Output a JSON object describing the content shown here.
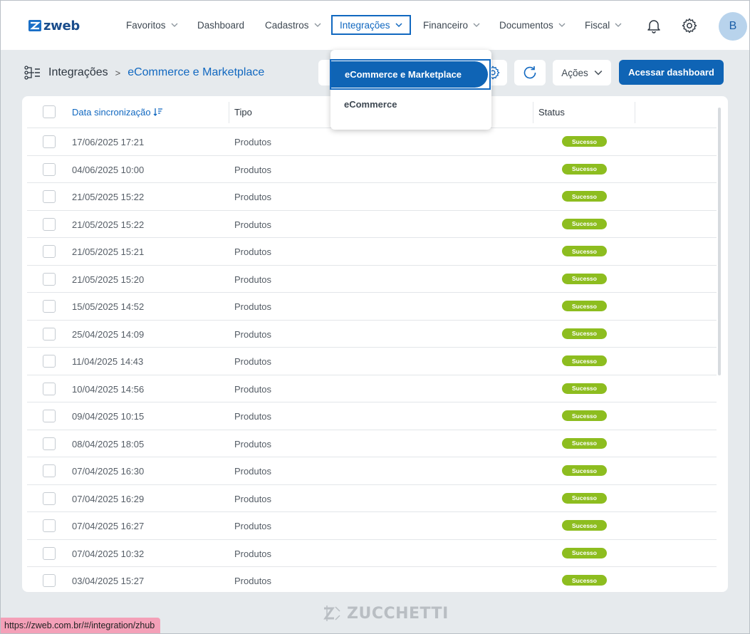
{
  "app": {
    "logo_text": "zweb"
  },
  "nav": {
    "items": [
      {
        "label": "Favoritos",
        "has_dropdown": true
      },
      {
        "label": "Dashboard",
        "has_dropdown": false
      },
      {
        "label": "Cadastros",
        "has_dropdown": true
      },
      {
        "label": "Integrações",
        "has_dropdown": true,
        "active": true
      },
      {
        "label": "Financeiro",
        "has_dropdown": true
      },
      {
        "label": "Documentos",
        "has_dropdown": true
      },
      {
        "label": "Fiscal",
        "has_dropdown": true
      }
    ],
    "avatar_initial": "B"
  },
  "breadcrumb": {
    "root": "Integrações",
    "separator": ">",
    "current": "eCommerce e Marketplace"
  },
  "toolbar": {
    "actions_label": "Ações",
    "primary_label": "Acessar dashboard"
  },
  "dropdown": {
    "items": [
      {
        "label": "eCommerce e Marketplace",
        "selected": true
      },
      {
        "label": "eCommerce",
        "selected": false
      }
    ]
  },
  "table": {
    "columns": {
      "date": "Data sincronização",
      "tipo": "Tipo",
      "status": "Status"
    },
    "rows": [
      {
        "date": "17/06/2025 17:21",
        "tipo": "Produtos",
        "status": "Sucesso"
      },
      {
        "date": "04/06/2025 10:00",
        "tipo": "Produtos",
        "status": "Sucesso"
      },
      {
        "date": "21/05/2025 15:22",
        "tipo": "Produtos",
        "status": "Sucesso"
      },
      {
        "date": "21/05/2025 15:22",
        "tipo": "Produtos",
        "status": "Sucesso"
      },
      {
        "date": "21/05/2025 15:21",
        "tipo": "Produtos",
        "status": "Sucesso"
      },
      {
        "date": "21/05/2025 15:20",
        "tipo": "Produtos",
        "status": "Sucesso"
      },
      {
        "date": "15/05/2025 14:52",
        "tipo": "Produtos",
        "status": "Sucesso"
      },
      {
        "date": "25/04/2025 14:09",
        "tipo": "Produtos",
        "status": "Sucesso"
      },
      {
        "date": "11/04/2025 14:43",
        "tipo": "Produtos",
        "status": "Sucesso"
      },
      {
        "date": "10/04/2025 14:56",
        "tipo": "Produtos",
        "status": "Sucesso"
      },
      {
        "date": "09/04/2025 10:15",
        "tipo": "Produtos",
        "status": "Sucesso"
      },
      {
        "date": "08/04/2025 18:05",
        "tipo": "Produtos",
        "status": "Sucesso"
      },
      {
        "date": "07/04/2025 16:30",
        "tipo": "Produtos",
        "status": "Sucesso"
      },
      {
        "date": "07/04/2025 16:29",
        "tipo": "Produtos",
        "status": "Sucesso"
      },
      {
        "date": "07/04/2025 16:27",
        "tipo": "Produtos",
        "status": "Sucesso"
      },
      {
        "date": "07/04/2025 10:32",
        "tipo": "Produtos",
        "status": "Sucesso"
      },
      {
        "date": "03/04/2025 15:27",
        "tipo": "Produtos",
        "status": "Sucesso"
      }
    ]
  },
  "footer": {
    "brand": "ZUCCHETTI"
  },
  "status_url": "https://zweb.com.br/#/integration/zhub",
  "colors": {
    "primary": "#0f64b5",
    "accent": "#1168c0",
    "success": "#8dbd1f",
    "status_bar": "#f4a0b8"
  }
}
